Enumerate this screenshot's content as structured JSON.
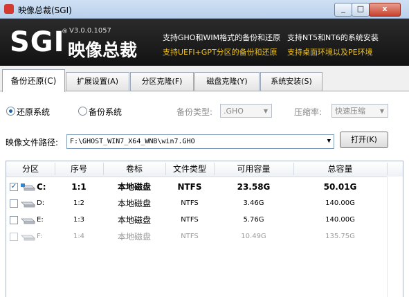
{
  "window": {
    "title": "映像总裁(SGI)",
    "close_label": "x",
    "min_label": "_",
    "max_label": "□"
  },
  "banner": {
    "logo": "SGI",
    "logo_reg": "®",
    "version": "V3.0.0.1057",
    "logo_cn": "映像总裁",
    "features": [
      "支持GHO和WIM格式的备份和还原",
      "支持NT5和NT6的系统安装",
      "支持UEFI+GPT分区的备份和还原",
      "支持桌面环境以及PE环境"
    ],
    "colors": {
      "white_text": "#ffffff",
      "highlight_text": "#f2c21b"
    }
  },
  "tabs": [
    {
      "label": "备份还原(C)",
      "active": true
    },
    {
      "label": "扩展设置(A)",
      "active": false
    },
    {
      "label": "分区克隆(F)",
      "active": false
    },
    {
      "label": "磁盘克隆(Y)",
      "active": false
    },
    {
      "label": "系统安装(S)",
      "active": false
    }
  ],
  "options": {
    "restore_label": "还原系统",
    "backup_label": "备份系统",
    "selected_mode": "还原系统",
    "backup_type_label": "备份类型:",
    "backup_type_value": ".GHO",
    "compression_label": "压缩率:",
    "compression_value": "快速压缩"
  },
  "image_path": {
    "label": "映像文件路径:",
    "value": "F:\\GHOST_WIN7_X64_WNB\\win7.GHO",
    "open_button": "打开(K)"
  },
  "table": {
    "columns": [
      "分区",
      "序号",
      "卷标",
      "文件类型",
      "可用容量",
      "总容量"
    ],
    "rows": [
      {
        "checked": true,
        "drive": "C:",
        "index": "1:1",
        "label": "本地磁盘",
        "fs": "NTFS",
        "free": "23.58G",
        "total": "50.01G"
      },
      {
        "checked": false,
        "drive": "D:",
        "index": "1:2",
        "label": "本地磁盘",
        "fs": "NTFS",
        "free": "3.46G",
        "total": "140.00G"
      },
      {
        "checked": false,
        "drive": "E:",
        "index": "1:3",
        "label": "本地磁盘",
        "fs": "NTFS",
        "free": "5.76G",
        "total": "140.00G"
      },
      {
        "checked": false,
        "drive": "F:",
        "index": "1:4",
        "label": "本地磁盘",
        "fs": "NTFS",
        "free": "10.49G",
        "total": "135.75G"
      }
    ],
    "check_mark": "✓"
  }
}
